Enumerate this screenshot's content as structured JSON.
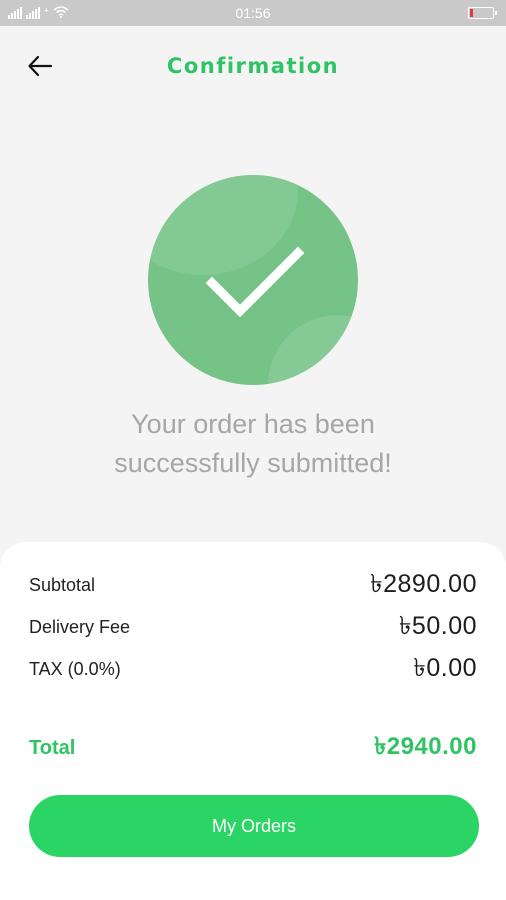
{
  "status_bar": {
    "time": "01:56",
    "icons": [
      "signal-icon",
      "signal-icon",
      "carrier-icon",
      "wifi-icon",
      "battery-icon"
    ],
    "battery_color": "#e43a3a"
  },
  "header": {
    "title": "Confirmation",
    "back_icon": "arrow-left-icon"
  },
  "success": {
    "icon": "check-circle-icon",
    "message_line1": "Your order has been",
    "message_line2": "successfully submitted!"
  },
  "summary": {
    "subtotal_label": "Subtotal",
    "subtotal_value": "৳2890.00",
    "delivery_label": "Delivery Fee",
    "delivery_value": "৳50.00",
    "tax_label": "TAX (0.0%)",
    "tax_value": "৳0.00",
    "total_label": "Total",
    "total_value": "৳2940.00"
  },
  "actions": {
    "my_orders_label": "My Orders"
  },
  "colors": {
    "accent": "#2ec464",
    "button": "#2bd565",
    "circle": "#75c387",
    "muted_text": "#a6a6a6"
  }
}
